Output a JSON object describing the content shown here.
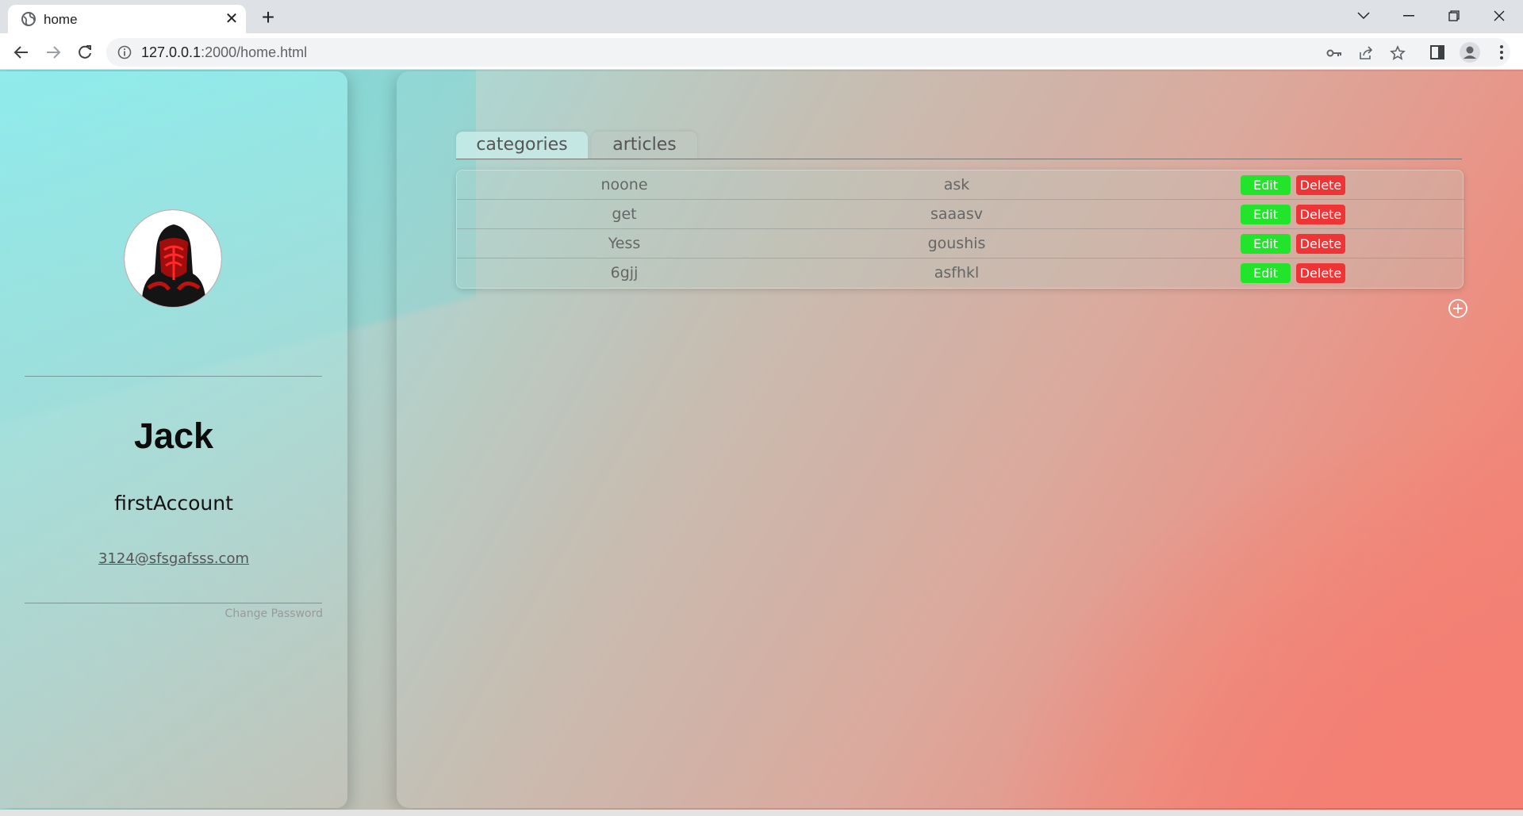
{
  "browser": {
    "tab_title": "home",
    "url_host": "127.0.0.1",
    "url_path": ":2000/home.html"
  },
  "profile": {
    "name": "Jack",
    "account": "firstAccount",
    "email": "3124@sfsgafsss.com",
    "change_password": "Change Password"
  },
  "tabs": [
    {
      "label": "categories",
      "active": true
    },
    {
      "label": "articles",
      "active": false
    }
  ],
  "rows": [
    {
      "name": "noone",
      "value": "ask"
    },
    {
      "name": "get",
      "value": "saaasv"
    },
    {
      "name": "Yess",
      "value": "goushis"
    },
    {
      "name": "6gjj",
      "value": "asfhkl"
    }
  ],
  "actions": {
    "edit": "Edit",
    "delete": "Delete"
  },
  "colors": {
    "edit": "#22e52b",
    "delete": "#ee3434"
  }
}
